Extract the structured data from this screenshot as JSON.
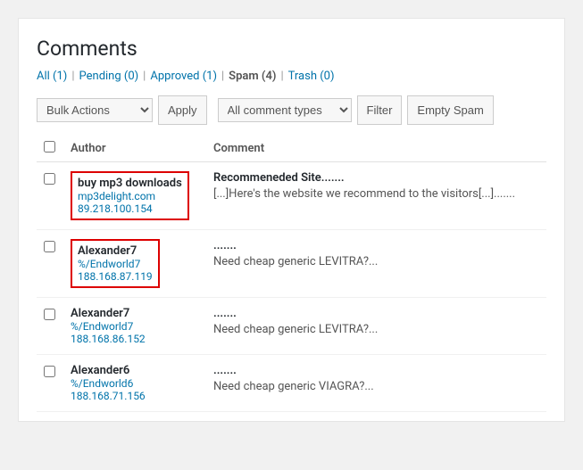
{
  "page": {
    "title": "Comments"
  },
  "nav": {
    "items": [
      {
        "label": "All (1)",
        "href": "#",
        "active": false
      },
      {
        "label": "Pending (0)",
        "href": "#",
        "active": false
      },
      {
        "label": "Approved (1)",
        "href": "#",
        "active": false
      },
      {
        "label": "Spam (4)",
        "href": "#",
        "active": true
      },
      {
        "label": "Trash (0)",
        "href": "#",
        "active": false
      }
    ]
  },
  "toolbar": {
    "bulk_actions_label": "Bulk Actions",
    "apply_label": "Apply",
    "comment_types_label": "All comment types",
    "filter_label": "Filter",
    "empty_spam_label": "Empty Spam"
  },
  "table": {
    "headers": {
      "author": "Author",
      "comment": "Comment"
    },
    "rows": [
      {
        "id": 1,
        "highlighted": true,
        "author_name": "buy mp3 downloads",
        "author_url": "mp3delight.com",
        "author_ip": "89.218.100.154",
        "comment_title": "Recommeneded Site.......",
        "comment_body": "[...]Here's the website we recommend to the visitors[...]......."
      },
      {
        "id": 2,
        "highlighted": true,
        "author_name": "Alexander7",
        "author_url": "%/Endworld7",
        "author_ip": "188.168.87.119",
        "comment_title": ".......",
        "comment_body": "Need cheap generic LEVITRA?..."
      },
      {
        "id": 3,
        "highlighted": false,
        "author_name": "Alexander7",
        "author_url": "%/Endworld7",
        "author_ip": "188.168.86.152",
        "comment_title": ".......",
        "comment_body": "Need cheap generic LEVITRA?..."
      },
      {
        "id": 4,
        "highlighted": false,
        "author_name": "Alexander6",
        "author_url": "%/Endworld6",
        "author_ip": "188.168.71.156",
        "comment_title": ".......",
        "comment_body": "Need cheap generic VIAGRA?..."
      }
    ]
  }
}
